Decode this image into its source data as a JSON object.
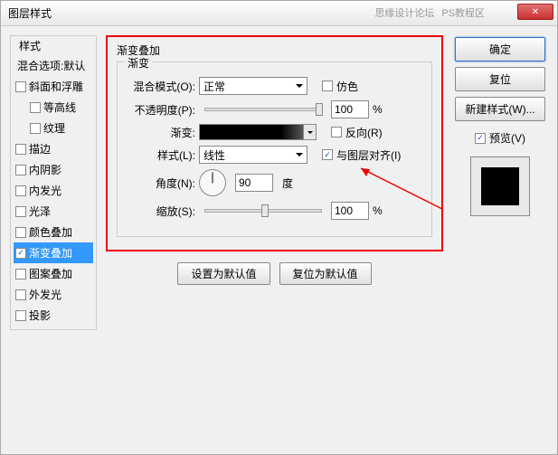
{
  "title": "图层样式",
  "watermark": {
    "a": "思缘设计论坛",
    "b": "PS教程区"
  },
  "left": {
    "groupLabel": "样式",
    "header": "混合选项:默认",
    "items": [
      {
        "label": "斜面和浮雕",
        "checked": false
      },
      {
        "label": "等高线",
        "checked": false,
        "indent": true
      },
      {
        "label": "纹理",
        "checked": false,
        "indent": true
      },
      {
        "label": "描边",
        "checked": false
      },
      {
        "label": "内阴影",
        "checked": false
      },
      {
        "label": "内发光",
        "checked": false
      },
      {
        "label": "光泽",
        "checked": false
      },
      {
        "label": "颜色叠加",
        "checked": false
      },
      {
        "label": "渐变叠加",
        "checked": true,
        "selected": true
      },
      {
        "label": "图案叠加",
        "checked": false
      },
      {
        "label": "外发光",
        "checked": false
      },
      {
        "label": "投影",
        "checked": false
      }
    ]
  },
  "center": {
    "groupTitle": "渐变叠加",
    "subTitle": "渐变",
    "blendMode": {
      "label": "混合模式(O):",
      "value": "正常"
    },
    "dither": {
      "label": "仿色"
    },
    "opacity": {
      "label": "不透明度(P):",
      "value": "100",
      "unit": "%"
    },
    "gradient": {
      "label": "渐变:"
    },
    "reverse": {
      "label": "反向(R)"
    },
    "style": {
      "label": "样式(L):",
      "value": "线性"
    },
    "align": {
      "label": "与图层对齐(I)",
      "checked": true
    },
    "angle": {
      "label": "角度(N):",
      "value": "90",
      "unit": "度"
    },
    "scale": {
      "label": "缩放(S):",
      "value": "100",
      "unit": "%"
    },
    "btnDefault": "设置为默认值",
    "btnReset": "复位为默认值"
  },
  "right": {
    "ok": "确定",
    "cancel": "复位",
    "newStyle": "新建样式(W)...",
    "preview": "预览(V)"
  }
}
